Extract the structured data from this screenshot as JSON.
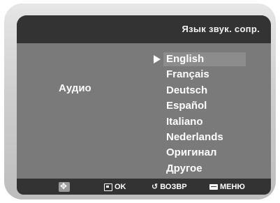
{
  "header": {
    "title": "Язык звук. сопр."
  },
  "section": {
    "label": "Аудио"
  },
  "languages": [
    {
      "label": "English",
      "selected": true
    },
    {
      "label": "Français",
      "selected": false
    },
    {
      "label": "Deutsch",
      "selected": false
    },
    {
      "label": "Español",
      "selected": false
    },
    {
      "label": "Italiano",
      "selected": false
    },
    {
      "label": "Nederlands",
      "selected": false
    },
    {
      "label": "Оригинал",
      "selected": false
    },
    {
      "label": "Другое",
      "selected": false
    }
  ],
  "footer": {
    "nav_icon": "directional-pad-icon",
    "ok_label": "OK",
    "back_label": "ВОЗВР",
    "menu_label": "МЕНЮ"
  },
  "colors": {
    "header_bg": "#333333",
    "content_bg": "#7a7a7a",
    "highlight_bg": "#8c8c8c",
    "text": "#ffffff"
  }
}
